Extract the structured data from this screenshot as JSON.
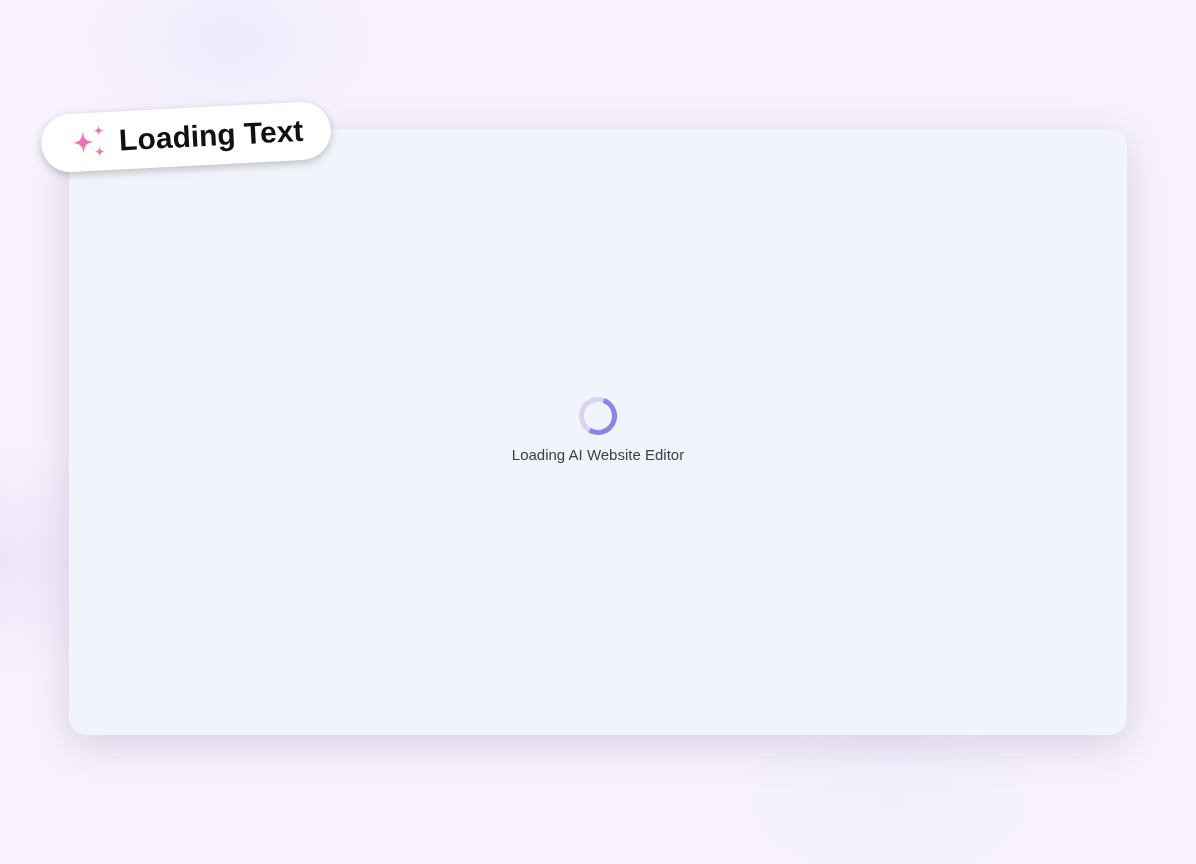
{
  "badge": {
    "label": "Loading Text"
  },
  "loader": {
    "message": "Loading AI Website Editor"
  }
}
